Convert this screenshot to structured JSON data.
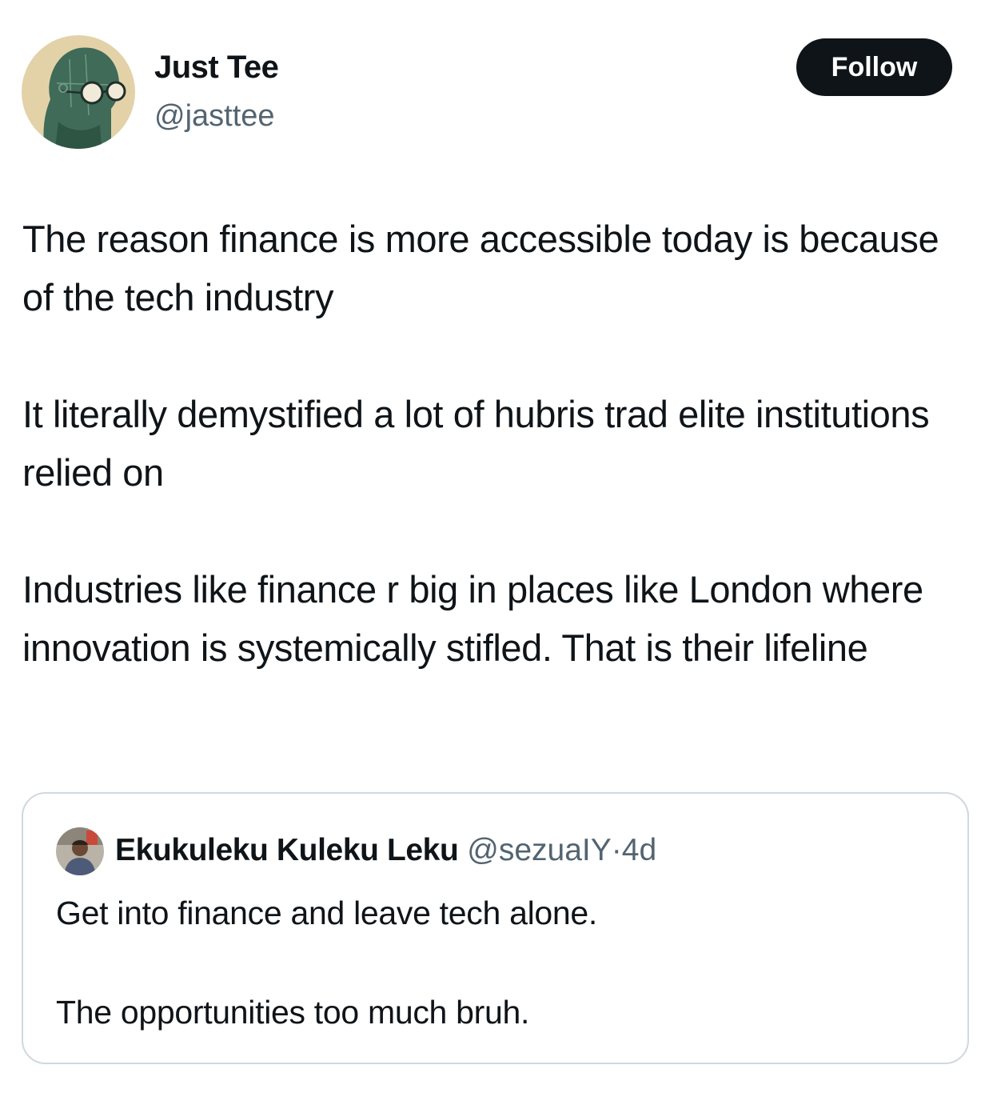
{
  "author": {
    "display_name": "Just Tee",
    "handle": "@jasttee",
    "avatar_icon": "robot-head-with-glasses-avatar"
  },
  "follow_button": {
    "label": "Follow"
  },
  "tweet": {
    "paragraphs": [
      "The reason finance is more accessible today is because of the tech industry",
      "It literally demystified a lot of hubris trad elite institutions relied on",
      "Industries like finance r big in places like London where innovation is systemically stifled. That is their lifeline"
    ]
  },
  "quoted_tweet": {
    "display_name": "Ekukuleku Kuleku Leku",
    "handle": "@sezuaIY",
    "separator": "·",
    "time": "4d",
    "paragraphs": [
      "Get into finance and leave tech alone.",
      "The opportunities too much bruh."
    ]
  },
  "colors": {
    "text_primary": "#0f1419",
    "text_secondary": "#536471",
    "follow_bg": "#0f1419",
    "card_border": "#cfd9de",
    "avatar_bg": "#e3d2a8",
    "avatar_head": "#3f6b58"
  }
}
